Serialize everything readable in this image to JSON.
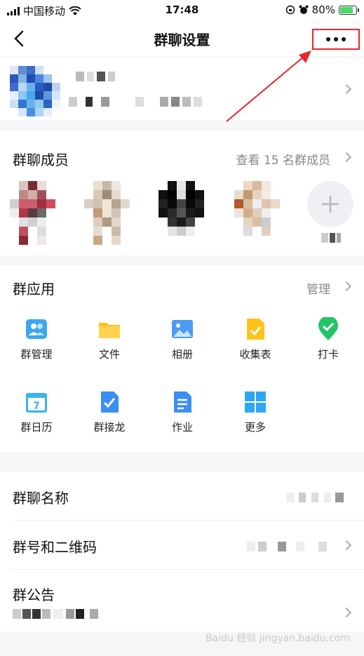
{
  "status_bar": {
    "carrier": "中国移动",
    "time": "17:48",
    "battery": "80%",
    "battery_level": 0.8
  },
  "nav": {
    "title": "群聊设置"
  },
  "members": {
    "title": "群聊成员",
    "view_all": "查看 15 名群成员"
  },
  "apps": {
    "title": "群应用",
    "manage": "管理",
    "items": [
      {
        "label": "群管理",
        "icon": "group-manage-icon",
        "color": "#3aa7f0"
      },
      {
        "label": "文件",
        "icon": "folder-icon",
        "color": "#ffc21b"
      },
      {
        "label": "相册",
        "icon": "album-icon",
        "color": "#4a9cf5"
      },
      {
        "label": "收集表",
        "icon": "collect-form-icon",
        "color": "#ffc21b"
      },
      {
        "label": "打卡",
        "icon": "check-in-icon",
        "color": "#23c56a"
      },
      {
        "label": "群日历",
        "icon": "calendar-icon",
        "color": "#3ab4f2"
      },
      {
        "label": "群接龙",
        "icon": "relay-icon",
        "color": "#3a8ef5"
      },
      {
        "label": "作业",
        "icon": "homework-icon",
        "color": "#3a8ef5"
      },
      {
        "label": "更多",
        "icon": "more-apps-icon",
        "color": "#2ea6f2"
      }
    ]
  },
  "rows": {
    "group_name": "群聊名称",
    "group_number": "群号和二维码",
    "announcement": "群公告"
  },
  "watermark": "Baidu 经验 jingyan.baidu.com",
  "colors": {
    "highlight": "#e8262c",
    "accent": "#12b7f5"
  }
}
